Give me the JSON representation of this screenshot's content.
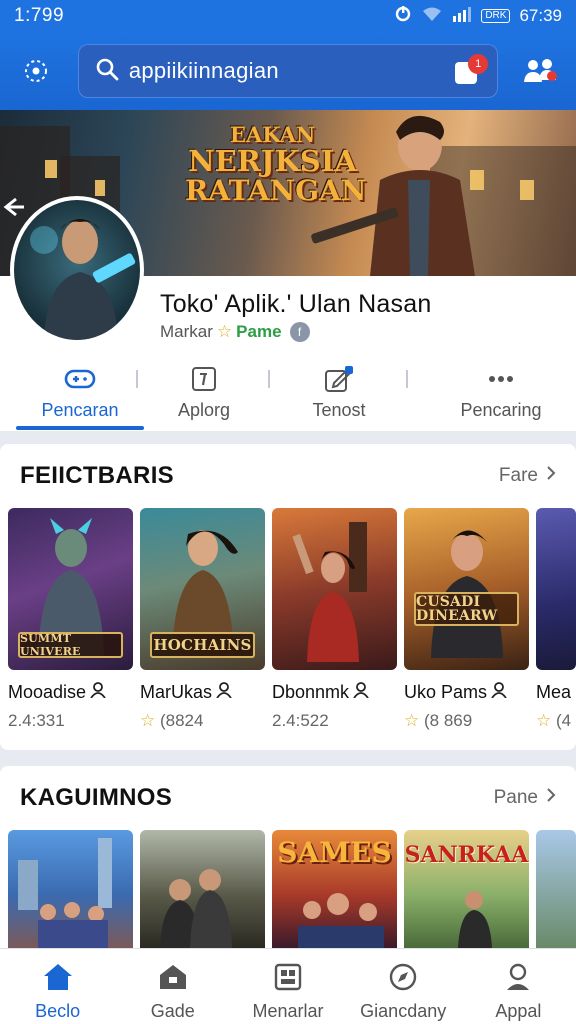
{
  "status_bar": {
    "time": "1:799",
    "battery": "DRK",
    "clock": "67:39"
  },
  "search": {
    "query": "appiikiinnagian"
  },
  "cart": {
    "badge": "1"
  },
  "banner": {
    "title_line1": "EAKAN",
    "title_line2": "NERJKSIA",
    "title_line3": "RATANGAN"
  },
  "app": {
    "name": "Toko' Aplik.' Ulan Nasan",
    "developer": "Markar",
    "badge": "Pame"
  },
  "tabs": [
    {
      "label": "Pencaran",
      "icon": "gamepad-icon",
      "active": true
    },
    {
      "label": "Aplorg",
      "icon": "info-icon",
      "active": false
    },
    {
      "label": "Tenost",
      "icon": "edit-icon",
      "active": false
    },
    {
      "label": "Pencaring",
      "icon": "more-icon",
      "active": false
    }
  ],
  "featured": {
    "title": "FEIICTBARIS",
    "more": "Fare",
    "items": [
      {
        "name": "Mooadise",
        "sub": "2.4:331",
        "plate": "SUMMT UNIVERE",
        "icon": "person-icon"
      },
      {
        "name": "MarUkas",
        "sub": "(8824",
        "plate": "HOCHAINS",
        "icon": "person-icon",
        "star": true
      },
      {
        "name": "Dbonnmk",
        "sub": "2.4:522",
        "plate": "",
        "icon": "person-icon"
      },
      {
        "name": "Uko Pams",
        "sub": "(8 869",
        "plate": "CUSADI DINEARW",
        "icon": "person-icon",
        "star": true
      },
      {
        "name": "Mea",
        "sub": "(4",
        "plate": "",
        "icon": "",
        "star": true
      }
    ]
  },
  "kaguimnos": {
    "title": "KAGUIMNOS",
    "more": "Pane",
    "items": [
      {
        "label": ""
      },
      {
        "label": ""
      },
      {
        "label": "SAMES"
      },
      {
        "label": "SANRKAA"
      },
      {
        "label": ""
      }
    ]
  },
  "bottom_nav": [
    {
      "label": "Beclo",
      "icon": "home-icon",
      "active": true
    },
    {
      "label": "Gade",
      "icon": "games-icon",
      "active": false
    },
    {
      "label": "Menarlar",
      "icon": "apps-icon",
      "active": false
    },
    {
      "label": "Giancdany",
      "icon": "compass-icon",
      "active": false
    },
    {
      "label": "Appal",
      "icon": "account-icon",
      "active": false
    }
  ],
  "colors": {
    "primary": "#1a66d2",
    "status_bar": "#1f73e0",
    "star": "#e0b020",
    "badge_green": "#2e9e44",
    "notification": "#e53935"
  }
}
